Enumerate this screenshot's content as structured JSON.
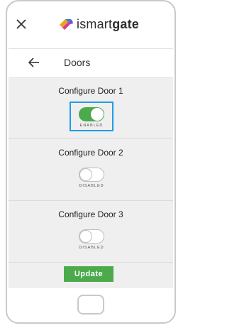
{
  "app": {
    "logo_text_light": "ismart",
    "logo_text_bold": "gate",
    "icons": {
      "close": "close-icon",
      "logo": "logo-mark",
      "back": "back-arrow-icon"
    }
  },
  "nav": {
    "title": "Doors"
  },
  "doors": [
    {
      "title": "Configure Door 1",
      "status": "ENABLED",
      "enabled": true,
      "focused": true
    },
    {
      "title": "Configure Door 2",
      "status": "DISABLED",
      "enabled": false,
      "focused": false
    },
    {
      "title": "Configure Door 3",
      "status": "DISABLED",
      "enabled": false,
      "focused": false
    }
  ],
  "actions": {
    "update_label": "Update"
  },
  "colors": {
    "accent_green": "#4caa4c",
    "focus_blue": "#1f9ce6",
    "background": "#efefef"
  }
}
